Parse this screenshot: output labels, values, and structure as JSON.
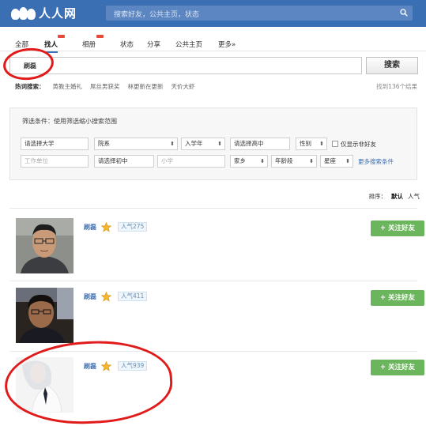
{
  "brand": {
    "logo_text": "人人网",
    "accent": "#3b6fb4"
  },
  "top_search": {
    "placeholder": "搜索好友，公共主页，状态",
    "icon": "search-icon"
  },
  "nav": {
    "items": [
      {
        "label": "全部",
        "active": false
      },
      {
        "label": "找人",
        "active": true
      },
      {
        "label": "相册",
        "active": false
      },
      {
        "label": "状态",
        "active": false
      },
      {
        "label": "分享",
        "active": false
      },
      {
        "label": "公共主页",
        "active": false
      },
      {
        "label": "更多»",
        "active": false
      }
    ]
  },
  "search": {
    "value": "刷磊",
    "button_label": "搜索"
  },
  "hot_search": {
    "label": "热词搜索：",
    "terms": [
      "黄教主婚礼",
      "屌丝男获奖",
      "林更新在更新",
      "天价大虾"
    ]
  },
  "result_count": "找到136个结果",
  "filter": {
    "title": "筛选条件：使用筛选缩小搜索范围",
    "university": "请选择大学",
    "department": "院系",
    "enroll_year": "入学年",
    "high_school": "请选择高中",
    "gender": "性别",
    "non_friends_only": "仅显示非好友",
    "workplace_placeholder": "工作单位",
    "junior_high": "请选择初中",
    "primary_placeholder": "小学",
    "hometown": "家乡",
    "age_group": "年龄段",
    "constellation": "星座",
    "more_conditions": "更多搜索条件"
  },
  "sort": {
    "label": "排序：",
    "options": [
      "默认",
      "人气"
    ]
  },
  "results": [
    {
      "name": "刷磊",
      "popularity": "人气275",
      "follow_label": "+ 关注好友"
    },
    {
      "name": "刷磊",
      "popularity": "人气411",
      "follow_label": "+ 关注好友"
    },
    {
      "name": "刷磊",
      "popularity": "人气939",
      "follow_label": "+ 关注好友"
    }
  ],
  "colors": {
    "follow_button": "#6bb55c",
    "highlight_circle": "#e11b1b",
    "link": "#3b6fb4"
  }
}
